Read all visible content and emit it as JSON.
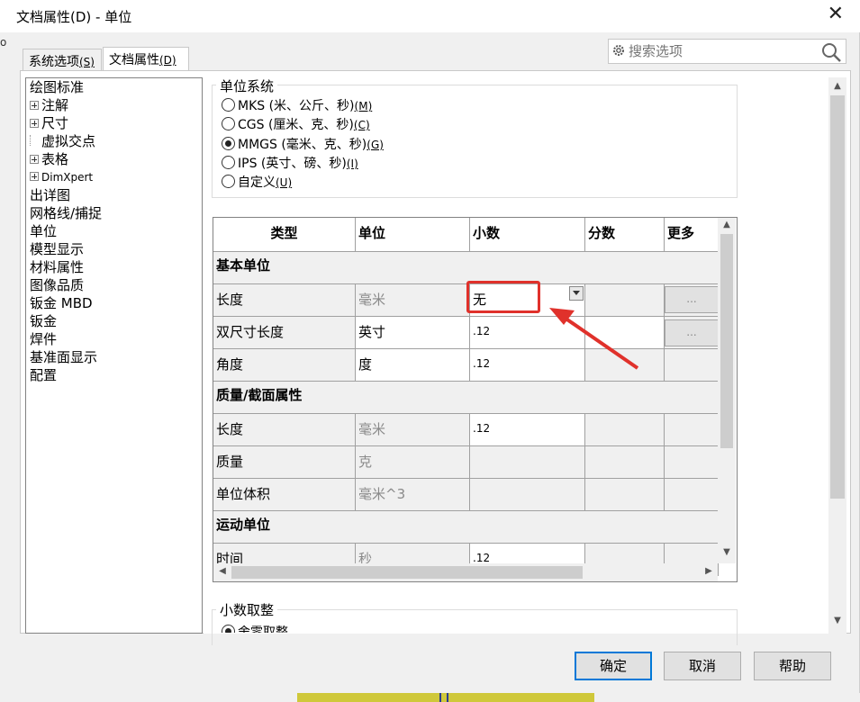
{
  "window": {
    "title": "文档属性(D) - 单位",
    "left_fragment": "o"
  },
  "tabs": {
    "system": {
      "label": "系统选项",
      "key": "(S)"
    },
    "document": {
      "label": "文档属性",
      "key": "(D)"
    }
  },
  "search": {
    "placeholder": "搜索选项"
  },
  "tree": [
    "绘图标准",
    "注解",
    "尺寸",
    "虚拟交点",
    "表格",
    "DimXpert",
    "出详图",
    "网格线/捕捉",
    "单位",
    "模型显示",
    "材料属性",
    "图像品质",
    "钣金 MBD",
    "钣金",
    "焊件",
    "基准面显示",
    "配置"
  ],
  "unit_system": {
    "title": "单位系统",
    "options": [
      {
        "label": "MKS (米、公斤、秒)",
        "key": "(M)",
        "selected": false
      },
      {
        "label": "CGS (厘米、克、秒)",
        "key": "(C)",
        "selected": false
      },
      {
        "label": "MMGS (毫米、克、秒)",
        "key": "(G)",
        "selected": true
      },
      {
        "label": "IPS (英寸、磅、秒)",
        "key": "(I)",
        "selected": false
      },
      {
        "label": "自定义",
        "key": "(U)",
        "selected": false
      }
    ]
  },
  "grid": {
    "headers": [
      "类型",
      "单位",
      "小数",
      "分数",
      "更多"
    ],
    "sections": {
      "basic": "基本单位",
      "mass": "质量/截面属性",
      "motion": "运动单位"
    },
    "rows": {
      "length": {
        "type": "长度",
        "unit": "毫米",
        "decimal": "无",
        "more": "..."
      },
      "dual": {
        "type": "双尺寸长度",
        "unit": "英寸",
        "decimal": ".12",
        "more": "..."
      },
      "angle": {
        "type": "角度",
        "unit": "度",
        "decimal": ".12"
      },
      "mass_length": {
        "type": "长度",
        "unit": "毫米",
        "decimal": ".12"
      },
      "mass": {
        "type": "质量",
        "unit": "克"
      },
      "volume": {
        "type": "单位体积",
        "unit": "毫米^3"
      },
      "time": {
        "type": "时间",
        "unit": "秒",
        "decimal": ".12"
      }
    }
  },
  "rounding": {
    "title": "小数取整",
    "first_option": "舍零取整"
  },
  "buttons": {
    "ok": "确定",
    "cancel": "取消",
    "help": "帮助"
  },
  "colors": {
    "accent": "#0078d7",
    "annotation": "#e0312b"
  }
}
